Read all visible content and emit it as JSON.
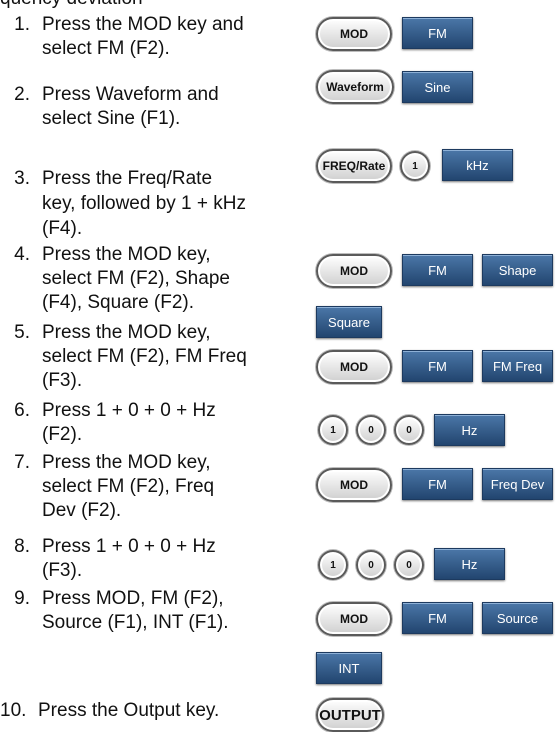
{
  "title_cut": "quency deviation",
  "steps": [
    {
      "num": "1.",
      "lines": [
        "Press the MOD key and",
        "select FM (F2)."
      ]
    },
    {
      "num": "2.",
      "lines": [
        "Press Waveform and",
        "select Sine (F1)."
      ]
    },
    {
      "num": "3.",
      "lines": [
        "Press the Freq/Rate",
        "key, followed by 1 + kHz",
        "(F4)."
      ]
    },
    {
      "num": "4.",
      "lines": [
        "Press the MOD key,",
        "select FM (F2), Shape",
        "(F4), Square (F2)."
      ]
    },
    {
      "num": "5.",
      "lines": [
        "Press the MOD key,",
        "select FM (F2), FM Freq",
        "(F3)."
      ]
    },
    {
      "num": "6.",
      "lines": [
        "Press 1 + 0 + 0 + Hz",
        "(F2)."
      ]
    },
    {
      "num": "7.",
      "lines": [
        "Press the MOD key,",
        "select FM (F2), Freq",
        "Dev (F2)."
      ]
    },
    {
      "num": "8.",
      "lines": [
        "Press 1 + 0 + 0 + Hz",
        "(F3)."
      ]
    },
    {
      "num": "9.",
      "lines": [
        "Press MOD, FM (F2),",
        "Source (F1), INT (F1)."
      ]
    },
    {
      "num": "10.",
      "lines": [
        "Press the Output key."
      ]
    }
  ],
  "keys": {
    "mod": "MOD",
    "waveform": "Waveform",
    "freq_rate": "FREQ/Rate",
    "one": "1",
    "zero": "0",
    "output": "OUTPUT"
  },
  "softkeys": {
    "fm": "FM",
    "sine": "Sine",
    "khz": "kHz",
    "shape": "Shape",
    "square": "Square",
    "fm_freq": "FM Freq",
    "hz": "Hz",
    "freq_dev": "Freq Dev",
    "source": "Source",
    "int": "INT"
  },
  "colors": {
    "softkey": "#2f5a8c",
    "softkey_text": "#ffffff"
  }
}
